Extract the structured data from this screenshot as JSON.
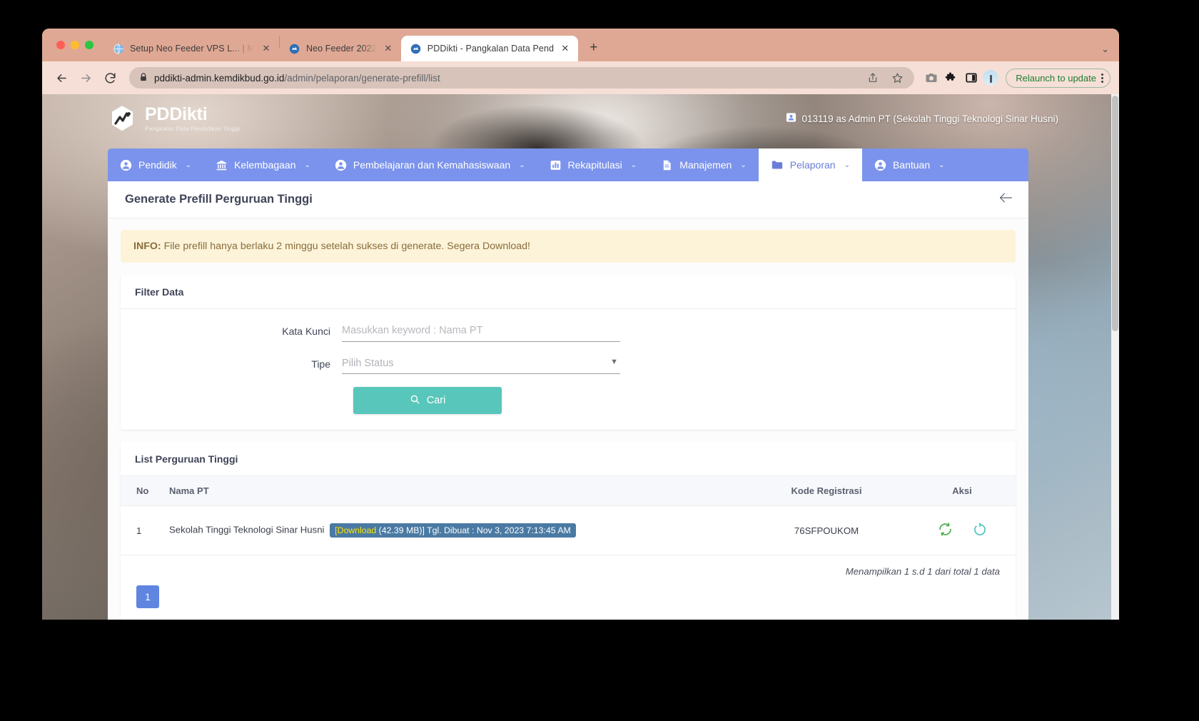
{
  "browser": {
    "tabs": [
      {
        "title": "Setup Neo Feeder VPS L... | M",
        "favicon": "globe-icon",
        "active": false
      },
      {
        "title": "Neo Feeder 2022",
        "favicon": "pddikti-icon",
        "active": false
      },
      {
        "title": "PDDikti - Pangkalan Data Pend",
        "favicon": "pddikti-icon",
        "active": true
      }
    ],
    "new_tab_label": "+",
    "tab_list_caret": "⌄",
    "omnibox": {
      "host": "pddikti-admin.kemdikbud.go.id",
      "path": "/admin/pelaporan/generate-prefill/list",
      "lock_icon": "lock-icon"
    },
    "toolbar_icons": [
      "back-icon",
      "forward-icon",
      "reload-icon",
      "share-icon",
      "bookmark-star-icon",
      "screenshot-icon",
      "extensions-puzzle-icon",
      "side-panel-icon",
      "profile-avatar-icon"
    ],
    "relaunch_label": "Relaunch to update"
  },
  "site": {
    "brand_title": "PDDikti",
    "brand_subtitle": "Pangkalan Data Pendidikan Tinggi",
    "user": "013119 as Admin PT (Sekolah Tinggi Teknologi Sinar Husni)",
    "user_icon": "user-badge-icon"
  },
  "nav": {
    "items": [
      {
        "label": "Pendidik",
        "icon": "person-icon",
        "caret": "⌄",
        "active": false
      },
      {
        "label": "Kelembagaan",
        "icon": "bank-icon",
        "caret": "⌄",
        "active": false
      },
      {
        "label": "Pembelajaran dan Kemahasiswaan",
        "icon": "person-icon",
        "caret": "⌄",
        "active": false
      },
      {
        "label": "Rekapitulasi",
        "icon": "bar-chart-icon",
        "caret": "⌄",
        "active": false
      },
      {
        "label": "Manajemen",
        "icon": "document-icon",
        "caret": "⌄",
        "active": false
      },
      {
        "label": "Pelaporan",
        "icon": "folder-icon",
        "caret": "⌄",
        "active": true
      },
      {
        "label": "Bantuan",
        "icon": "help-person-icon",
        "caret": "⌄",
        "active": false
      }
    ]
  },
  "page": {
    "title": "Generate Prefill Perguruan Tinggi",
    "back_icon": "arrow-left-icon",
    "info_label": "INFO:",
    "info_text": "File prefill hanya berlaku 2 minggu setelah sukses di generate. Segera Download!"
  },
  "filter": {
    "card_title": "Filter Data",
    "kata_kunci_label": "Kata Kunci",
    "kata_kunci_value": "",
    "kata_kunci_placeholder": "Masukkan keyword : Nama PT",
    "tipe_label": "Tipe",
    "tipe_value": "Pilih Status",
    "tipe_caret": "▼",
    "search_button_label": "Cari",
    "search_button_icon": "search-icon",
    "search_button_color": "#58c6bb"
  },
  "list": {
    "card_title": "List Perguruan Tinggi",
    "columns": [
      "No",
      "Nama PT",
      "Kode Registrasi",
      "Aksi"
    ],
    "rows": [
      {
        "no": "1",
        "nama_pt": "Sekolah Tinggi Teknologi Sinar Husni",
        "badge_link": "[Download",
        "badge_rest": " (42.39 MB)] Tgl. Dibuat : Nov 3, 2023 7:13:45 AM",
        "kode_registrasi": "76SFPOUKOM",
        "actions": [
          {
            "icon": "regenerate-sync-icon",
            "color": "#4caf50"
          },
          {
            "icon": "refresh-status-icon",
            "color": "#4bc3bb"
          }
        ]
      }
    ],
    "summary": "Menampilkan 1 s.d 1 dari total 1 data",
    "pagination": [
      "1"
    ],
    "active_page": "1"
  }
}
